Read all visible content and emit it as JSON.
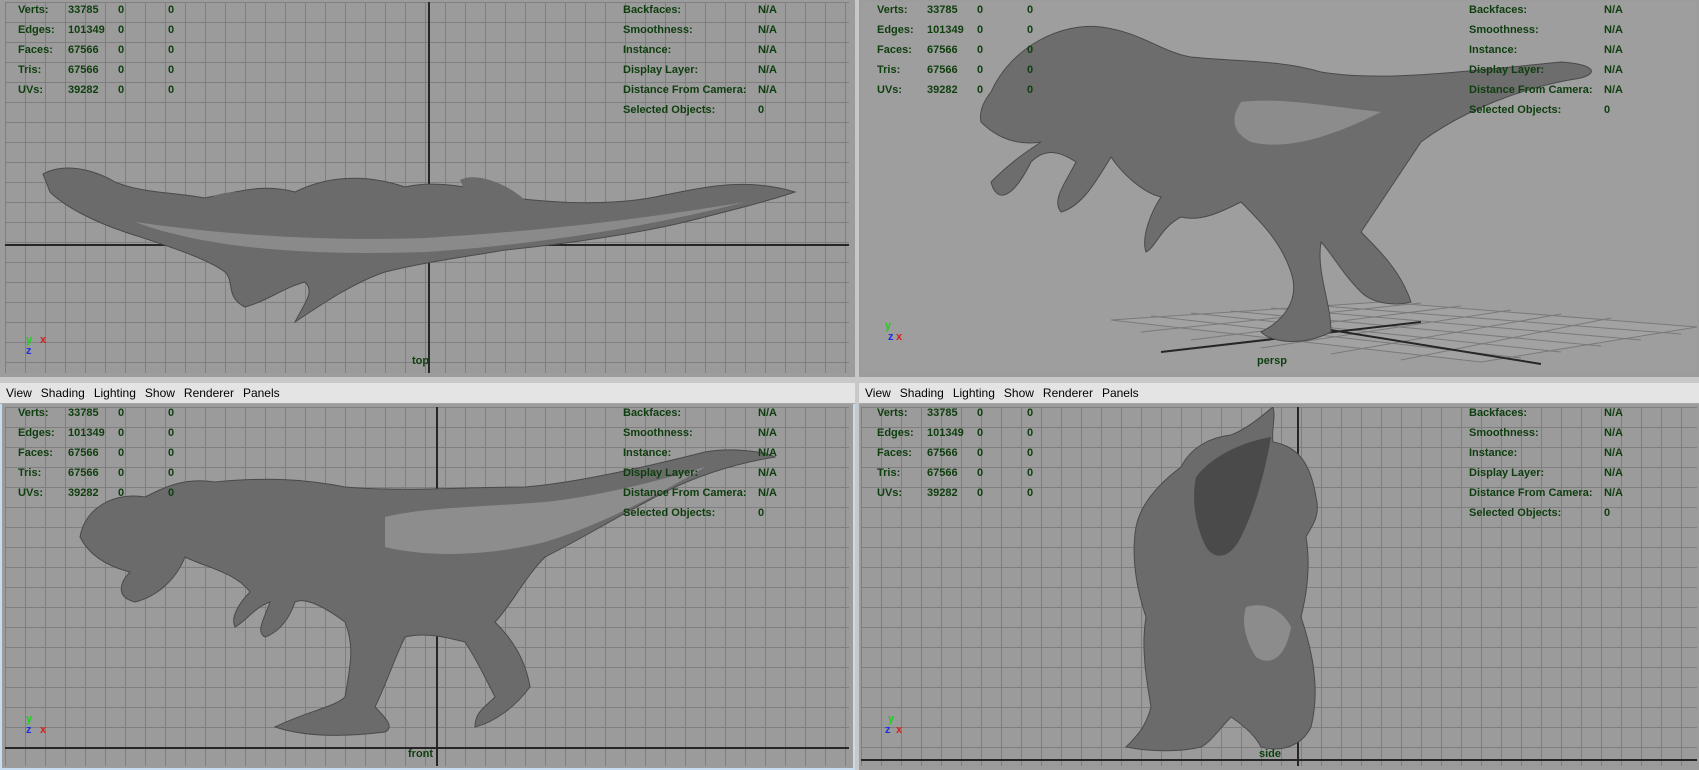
{
  "menu": {
    "view": "View",
    "shading": "Shading",
    "lighting": "Lighting",
    "show": "Show",
    "renderer": "Renderer",
    "panels": "Panels"
  },
  "stats": {
    "verts": {
      "label": "Verts:",
      "v1": "33785",
      "v2": "0",
      "v3": "0"
    },
    "edges": {
      "label": "Edges:",
      "v1": "101349",
      "v2": "0",
      "v3": "0"
    },
    "faces": {
      "label": "Faces:",
      "v1": "67566",
      "v2": "0",
      "v3": "0"
    },
    "tris": {
      "label": "Tris:",
      "v1": "67566",
      "v2": "0",
      "v3": "0"
    },
    "uvs": {
      "label": "UVs:",
      "v1": "39282",
      "v2": "0",
      "v3": "0"
    }
  },
  "info": {
    "backfaces": {
      "label": "Backfaces:",
      "value": "N/A"
    },
    "smoothness": {
      "label": "Smoothness:",
      "value": "N/A"
    },
    "instance": {
      "label": "Instance:",
      "value": "N/A"
    },
    "display_layer": {
      "label": "Display Layer:",
      "value": "N/A"
    },
    "distance": {
      "label": "Distance From Camera:",
      "value": "N/A"
    },
    "selected": {
      "label": "Selected Objects:",
      "value": "0"
    }
  },
  "cameras": {
    "top": "top",
    "persp": "persp",
    "front": "front",
    "side": "side"
  },
  "gizmo": {
    "x": "x",
    "y": "y",
    "z": "z"
  },
  "icons": {
    "axis": "axis-gizmo-icon"
  },
  "colors": {
    "hud_text": "#0e3e0e",
    "viewport_bg": "#9b9b9b",
    "grid": "#7f7f7f",
    "model": "#6c6c6c"
  }
}
